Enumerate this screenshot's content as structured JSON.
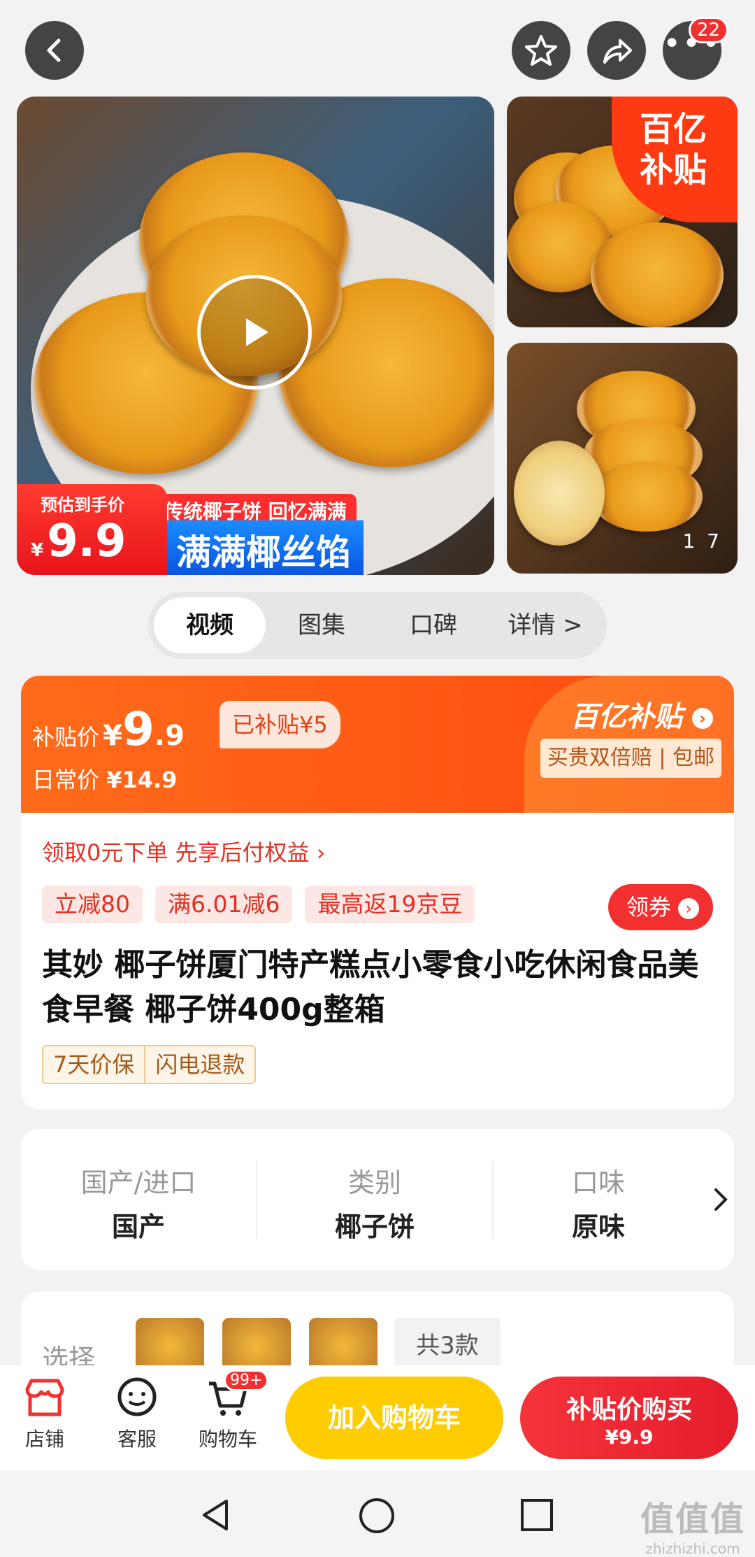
{
  "topbar": {
    "more_badge": "22"
  },
  "gallery": {
    "main_price_label": "预估到手价",
    "main_price_currency": "¥",
    "main_price_value": "9.9",
    "promo_line": "传统椰子饼 回忆满满",
    "promo_big": "满满椰丝馅",
    "corner_line1": "百亿",
    "corner_line2": "补贴",
    "counter_current": "1",
    "counter_total": "7"
  },
  "tabs": [
    {
      "label": "视频"
    },
    {
      "label": "图集"
    },
    {
      "label": "口碑"
    },
    {
      "label": "详情 >"
    }
  ],
  "price": {
    "subsidy_label": "补贴价",
    "currency": "¥",
    "integer": "9",
    "decimal": ".9",
    "subsidized": "已补贴¥5",
    "daily_label": "日常价",
    "daily_value": "¥14.9",
    "brand": "百亿补贴",
    "guarantee": "买贵双倍赔 | 包邮"
  },
  "offer": {
    "pay_later": "领取0元下单 先享后付权益 ›",
    "coupons": [
      "立减80",
      "满6.01减6",
      "最高返19京豆"
    ],
    "claim_button": "领券"
  },
  "product": {
    "title": "其妙 椰子饼厦门特产糕点小零食小吃休闲食品美食早餐 椰子饼400g整箱",
    "service1": "7天价保",
    "service2": "闪电退款"
  },
  "params": [
    {
      "key": "国产/进口",
      "value": "国产"
    },
    {
      "key": "类别",
      "value": "椰子饼"
    },
    {
      "key": "口味",
      "value": "原味"
    }
  ],
  "select": {
    "label": "选择",
    "count": "共3款"
  },
  "bottom_bar": {
    "shop": "店铺",
    "service": "客服",
    "cart": "购物车",
    "cart_badge": "99+",
    "add_cart": "加入购物车",
    "buy_line1": "补贴价购买",
    "buy_line2": "¥9.9"
  },
  "watermark": {
    "line1": "值值值",
    "line2": "zhizhizhi.com"
  },
  "colors": {
    "accent_red": "#f23030",
    "subsidy_orange": "#ff5a14",
    "cart_yellow": "#ffcc00"
  }
}
